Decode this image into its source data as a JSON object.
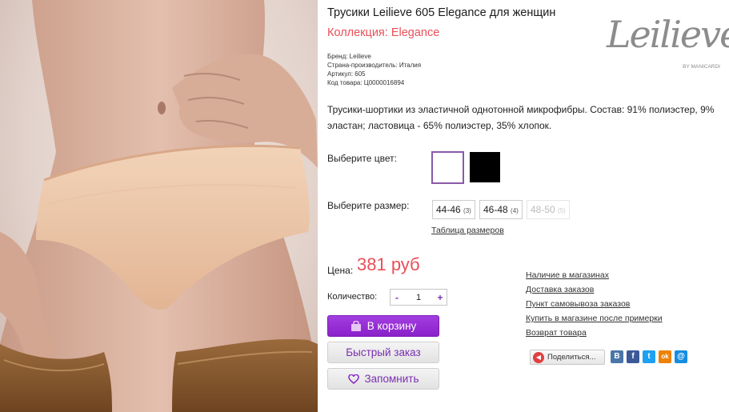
{
  "product": {
    "title": "Трусики Leilieve 605 Elegance для женщин",
    "collection": "Коллекция: Elegance",
    "specs": [
      "Бренд: Leilieve",
      "Страна-производитель: Италия",
      "Артикул: 605",
      "Код товара: Ц0000016894"
    ],
    "description": "Трусики-шортики из эластичной однотонной микрофибры. Состав: 91% полиэстер, 9% эластан; ластовица - 65% полиэстер, 35% хлопок."
  },
  "logo": {
    "word": "Leilieve",
    "sub": "BY MANICARDI"
  },
  "color_select": {
    "label": "Выберите цвет:",
    "swatches": [
      {
        "name": "white",
        "hex": "#ffffff",
        "selected": true
      },
      {
        "name": "black",
        "hex": "#000000",
        "selected": false
      }
    ]
  },
  "size_select": {
    "label": "Выберите размер:",
    "options": [
      {
        "size": "44-46",
        "count": "(3)",
        "available": true
      },
      {
        "size": "46-48",
        "count": "(4)",
        "available": true
      },
      {
        "size": "48-50",
        "count": "(5)",
        "available": false
      }
    ],
    "table_link": "Таблица размеров"
  },
  "price": {
    "label": "Цена:",
    "value": "381 руб"
  },
  "quantity": {
    "label": "Количество:",
    "minus": "-",
    "value": "1",
    "plus": "+"
  },
  "buttons": {
    "cart": "В корзину",
    "quick_order": "Быстрый заказ",
    "remember": "Запомнить"
  },
  "info_links": [
    "Наличие в магазинах",
    "Доставка заказов",
    "Пункт самовывоза заказов",
    "Купить в магазине после примерки",
    "Возврат товара"
  ],
  "share": {
    "label": "Поделиться...",
    "networks": [
      {
        "name": "vkontakte",
        "glyph": "В",
        "color": "#4a76a8"
      },
      {
        "name": "facebook",
        "glyph": "f",
        "color": "#3b5998"
      },
      {
        "name": "twitter",
        "glyph": "t",
        "color": "#1da1f2"
      },
      {
        "name": "odnoklassniki",
        "glyph": "ok",
        "color": "#ee8208"
      },
      {
        "name": "mailru",
        "glyph": "@",
        "color": "#168de2"
      }
    ]
  },
  "colors": {
    "accent": "#8a21c9",
    "price": "#e94f57",
    "link": "#333333"
  }
}
